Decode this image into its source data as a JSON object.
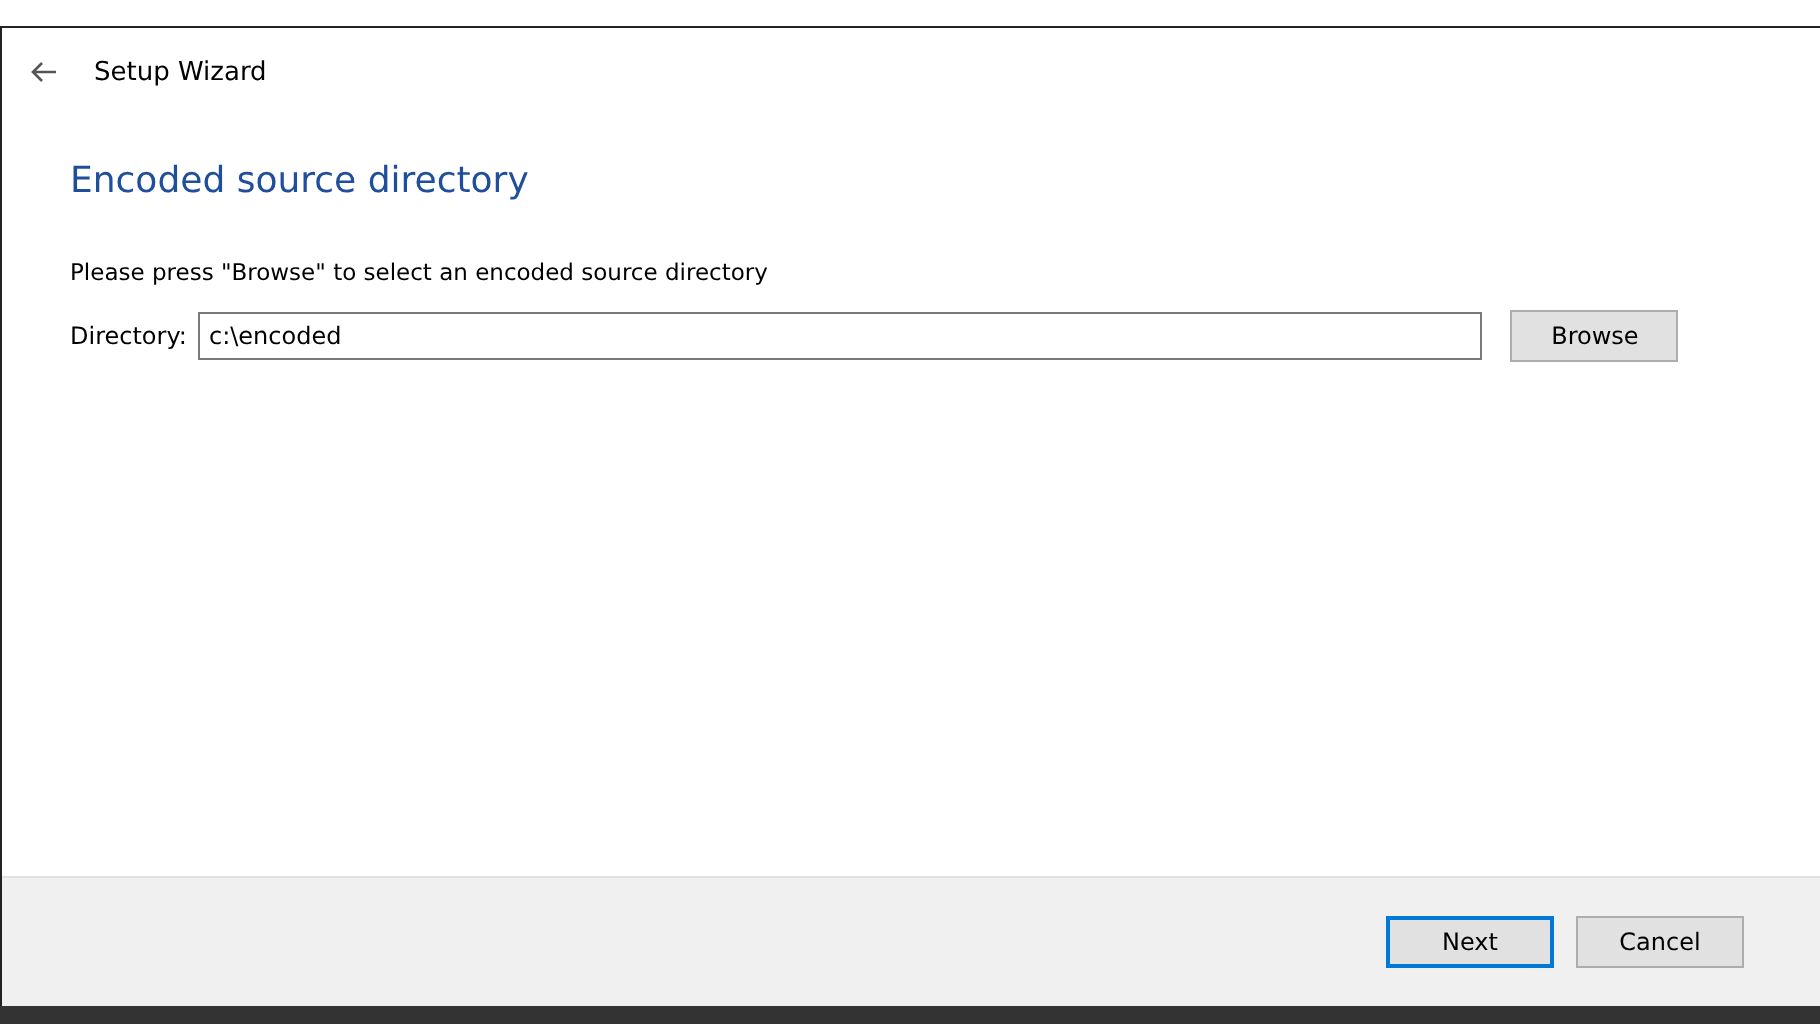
{
  "window": {
    "title": "Setup Wizard"
  },
  "page": {
    "heading": "Encoded source directory",
    "instruction": "Please press \"Browse\" to select an encoded source directory"
  },
  "directory": {
    "label": "Directory:",
    "value": "c:\\encoded",
    "button": "Browse"
  },
  "buttons": [
    {
      "label": "Next",
      "default": true
    },
    {
      "label": "Cancel",
      "default": false
    }
  ]
}
